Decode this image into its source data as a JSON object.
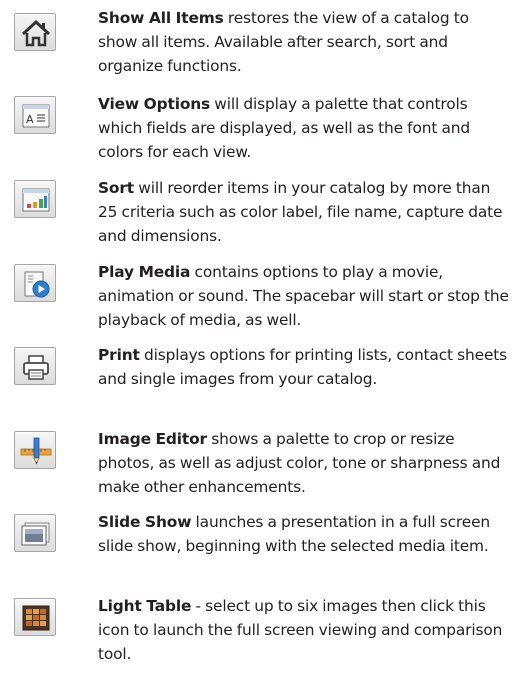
{
  "items": [
    {
      "name": "Show All Items",
      "icon": "home-icon",
      "text": " restores the view of a catalog to show all items. Available after search, sort and organize functions."
    },
    {
      "name": "View Options",
      "icon": "view-options-icon",
      "text": " will display a palette that controls which fields are displayed, as well as the font and colors for each view."
    },
    {
      "name": "Sort",
      "icon": "sort-chart-icon",
      "text": " will reorder items in your catalog by more than 25 criteria such as color label, file name, capture date and dimensions."
    },
    {
      "name": "Play Media",
      "icon": "play-media-icon",
      "text": " contains options to play a movie, animation or sound. The spacebar will start or stop the playback of media, as well."
    },
    {
      "name": "Print",
      "icon": "printer-icon",
      "text": " displays options for printing lists, contact sheets and single images from your catalog."
    },
    {
      "name": "Image Editor",
      "icon": "image-editor-icon",
      "text": " shows a palette to crop or resize photos, as well as adjust color, tone or sharpness and make other enhancements."
    },
    {
      "name": "Slide Show",
      "icon": "slide-show-icon",
      "text": " launches a presentation in a full screen slide show, beginning with the selected media item."
    },
    {
      "name": "Light Table",
      "icon": "light-table-icon",
      "text": " - select up to six images then click this icon to launch the full screen viewing and comparison tool."
    }
  ]
}
